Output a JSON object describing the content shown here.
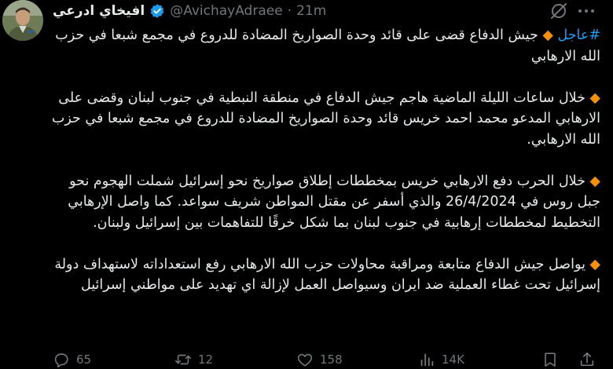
{
  "author": {
    "name": "افيخاي ادرعي",
    "handle": "@AvichayAdraee",
    "time": "21m",
    "dot": "·"
  },
  "tweet": {
    "hashtag": "#عاجل",
    "bullet": "◆",
    "paragraphs": [
      {
        "text": "جيش الدفاع قضى على قائد وحدة  الصواريخ المضادة للدروع في مجمع شبعا في حزب الله الارهابي"
      },
      {
        "text": "خلال ساعات الليلة الماضية هاجم جيش الدفاع في منطقة النبطية في جنوب لبنان وقضى على الارهابي المدعو محمد احمد خريس قائد وحدة الصواريخ المضادة للدروع في مجمع شبعا في حزب الله الارهابي."
      },
      {
        "text": "خلال الحرب دفع الارهابي خريس بمخططات إطلاق صواريخ نحو إسرائيل شملت الهجوم نحو جبل روس في 26/4/2024 والذي أسفر عن مقتل المواطن شريف سواعد. كما واصل الإرهابي التخطيط لمخططات إرهابية في جنوب لبنان بما شكل خرقًا للتفاهمات بين إسرائيل ولبنان."
      },
      {
        "text": "يواصل جيش الدفاع متابعة ومراقبة محاولات حزب الله الارهابي رفع استعداداته لاستهداف دولة إسرائيل تحت غطاء العملية ضد ايران وسيواصل العمل لإزالة اي تهديد على مواطني إسرائيل"
      }
    ]
  },
  "actions": {
    "replies": "65",
    "reposts": "12",
    "likes": "158",
    "views": "14K"
  },
  "colors": {
    "background": "#000000",
    "text": "#e7e9ea",
    "muted": "#71767b",
    "hashtag": "#1d9bf0",
    "bullet": "#f4900c",
    "verified": "#1d9bf0"
  }
}
